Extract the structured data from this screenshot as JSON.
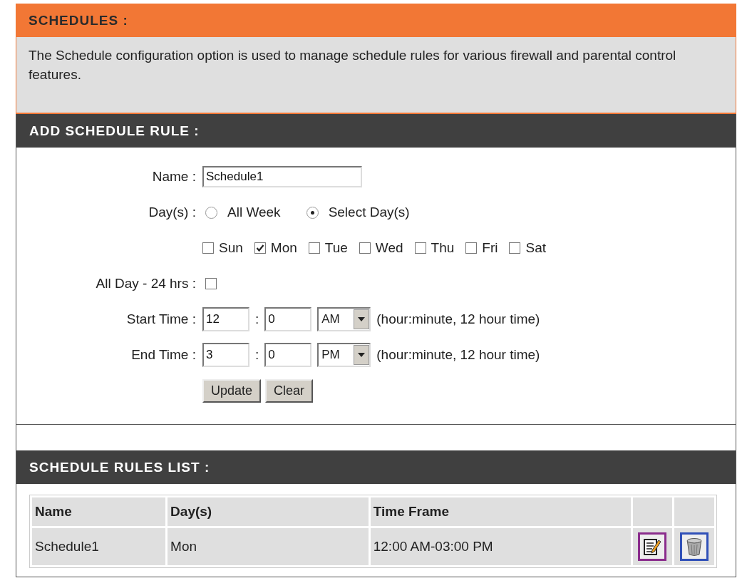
{
  "schedules": {
    "title": "SCHEDULES :",
    "description": "The Schedule configuration option is used to manage schedule rules for various firewall and parental control features."
  },
  "add_rule": {
    "title": "ADD SCHEDULE RULE :",
    "name_label": "Name :",
    "name_value": "Schedule1",
    "days_label": "Day(s) :",
    "day_modes": [
      {
        "label": "All Week",
        "selected": false
      },
      {
        "label": "Select Day(s)",
        "selected": true
      }
    ],
    "days": [
      {
        "label": "Sun",
        "checked": false
      },
      {
        "label": "Mon",
        "checked": true
      },
      {
        "label": "Tue",
        "checked": false
      },
      {
        "label": "Wed",
        "checked": false
      },
      {
        "label": "Thu",
        "checked": false
      },
      {
        "label": "Fri",
        "checked": false
      },
      {
        "label": "Sat",
        "checked": false
      }
    ],
    "all_day_label": "All Day - 24 hrs :",
    "all_day_checked": false,
    "times": [
      {
        "label": "Start Time :",
        "hour": "12",
        "separator": ":",
        "minute": "0",
        "period": "AM",
        "hint": "(hour:minute, 12 hour time)"
      },
      {
        "label": "End Time :",
        "hour": "3",
        "separator": ":",
        "minute": "0",
        "period": "PM",
        "hint": "(hour:minute, 12 hour time)"
      }
    ],
    "buttons": [
      "Update",
      "Clear"
    ]
  },
  "rules_list": {
    "title": "SCHEDULE RULES LIST :",
    "columns": [
      "Name",
      "Day(s)",
      "Time Frame"
    ],
    "rows": [
      {
        "cells": [
          "Schedule1",
          "Mon",
          "12:00 AM-03:00 PM"
        ]
      }
    ]
  }
}
